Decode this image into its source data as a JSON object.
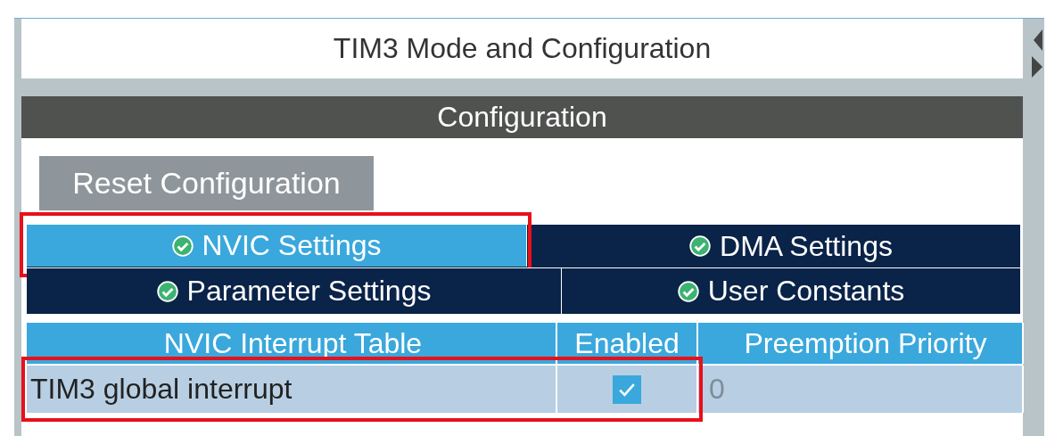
{
  "panel": {
    "title": "TIM3 Mode and Configuration"
  },
  "configuration": {
    "header": "Configuration",
    "reset_button": "Reset Configuration"
  },
  "tabs": [
    {
      "label": "NVIC Settings",
      "selected": true,
      "highlighted": true
    },
    {
      "label": "DMA Settings",
      "selected": false,
      "highlighted": false
    },
    {
      "label": "Parameter Settings",
      "selected": false,
      "highlighted": false
    },
    {
      "label": "User Constants",
      "selected": false,
      "highlighted": false
    }
  ],
  "table": {
    "columns": [
      "NVIC Interrupt Table",
      "Enabled",
      "Preemption Priority"
    ],
    "rows": [
      {
        "name": "TIM3 global interrupt",
        "enabled": true,
        "priority": "0",
        "priority_disabled": true,
        "highlighted": true
      }
    ]
  }
}
